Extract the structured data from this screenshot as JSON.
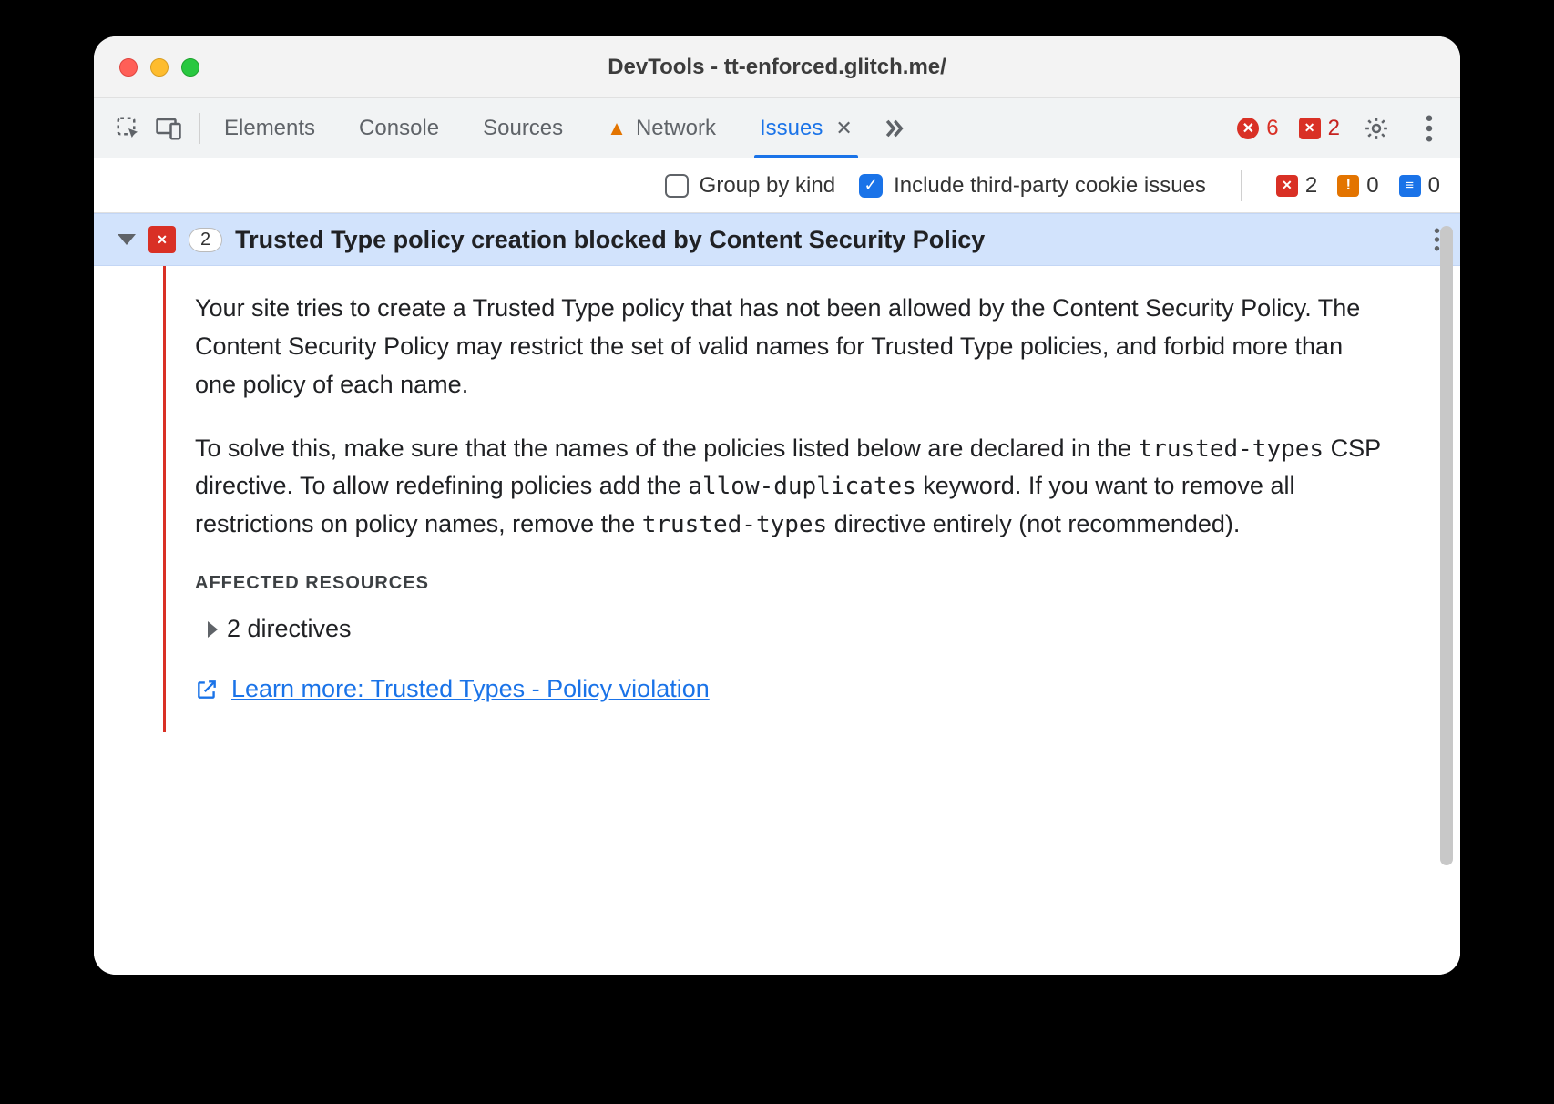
{
  "title": "DevTools - tt-enforced.glitch.me/",
  "tabs": {
    "elements": "Elements",
    "console": "Console",
    "sources": "Sources",
    "network": "Network",
    "issues": "Issues"
  },
  "header_counts": {
    "errors": "6",
    "page_errors": "2"
  },
  "filters": {
    "group_by_kind": "Group by kind",
    "include_3p": "Include third-party cookie issues"
  },
  "filter_counts": {
    "page_errors": "2",
    "issues": "0",
    "info": "0"
  },
  "issue": {
    "count": "2",
    "title": "Trusted Type policy creation blocked by Content Security Policy",
    "p1a": "Your site tries to create a Trusted Type policy that has not been allowed by the Content Security Policy. The Content Security Policy may restrict the set of valid names for Trusted Type policies, and forbid more than one policy of each name.",
    "p2a": "To solve this, make sure that the names of the policies listed below are declared in the ",
    "p2code1": "trusted-types",
    "p2b": " CSP directive. To allow redefining policies add the ",
    "p2code2": "allow-duplicates",
    "p2c": " keyword. If you want to remove all restrictions on policy names, remove the ",
    "p2code3": "trusted-types",
    "p2d": " directive entirely (not recommended).",
    "affected_heading": "Affected Resources",
    "directives": "2 directives",
    "learn_more": "Learn more: Trusted Types - Policy violation"
  }
}
